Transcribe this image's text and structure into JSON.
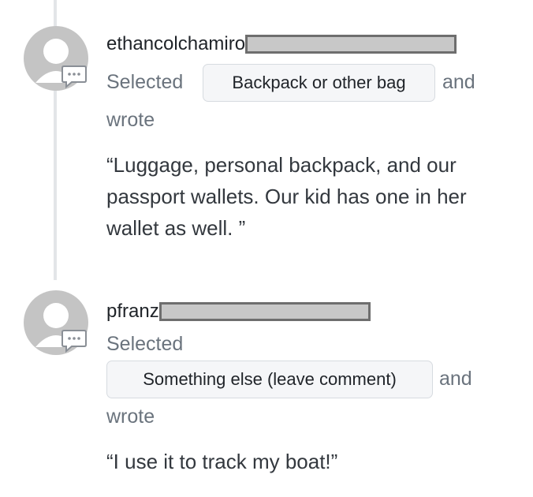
{
  "entries": [
    {
      "username": "ethancolchamiro",
      "selected_label": "Selected",
      "choice": "Backpack or other bag",
      "and_label": "and",
      "wrote_label": "wrote",
      "quote": "“Luggage, personal backpack, and our passport wallets. Our kid has one in her wallet as well. ”"
    },
    {
      "username": "pfranz",
      "selected_label": "Selected",
      "choice": "Something else (leave comment)",
      "and_label": "and",
      "wrote_label": "wrote",
      "quote": "“I use it to track my boat!”"
    }
  ]
}
